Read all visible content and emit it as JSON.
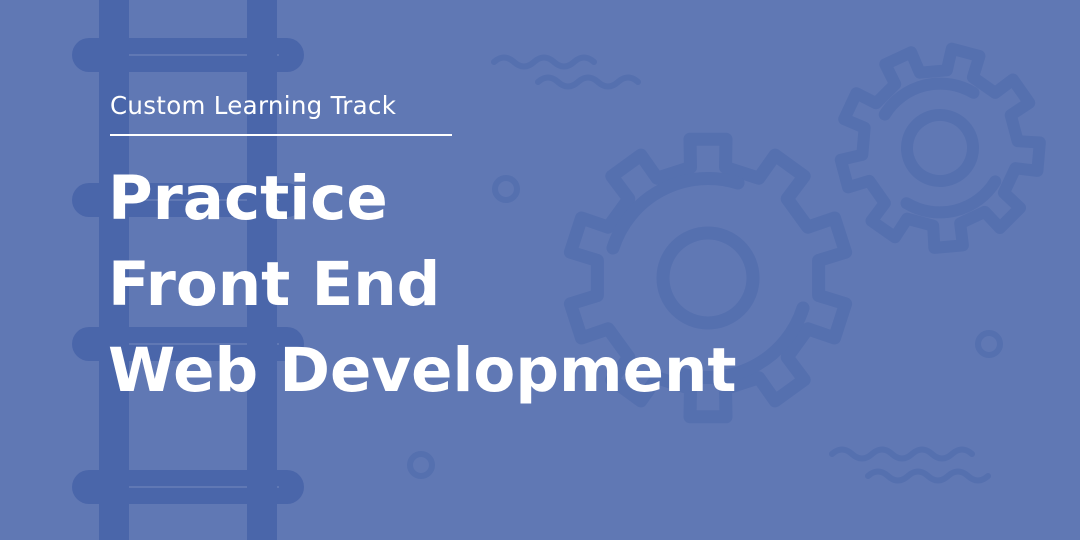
{
  "banner": {
    "kicker": "Custom Learning Track",
    "title_lines": [
      "Practice",
      "Front End",
      "Web Development"
    ]
  },
  "colors": {
    "background": "#6078b4",
    "rails": "#4a66aa",
    "decor": "#5570af",
    "text": "#ffffff"
  },
  "icons": [
    "ladder-decoration",
    "large-gear-icon",
    "small-gear-icon",
    "wave-decoration",
    "circle-decoration"
  ]
}
